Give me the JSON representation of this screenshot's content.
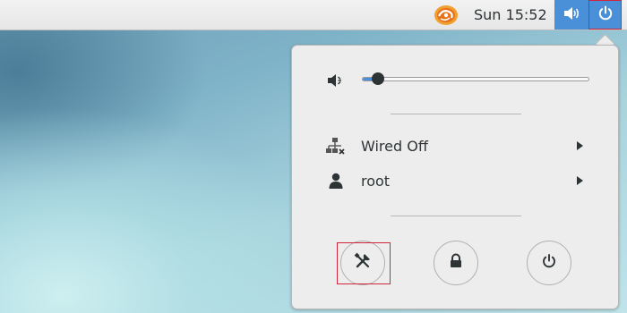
{
  "topbar": {
    "clock": "Sun 15:52",
    "icons": {
      "app": "app-menu-swirl-icon",
      "volume": "volume-icon",
      "power": "power-icon"
    },
    "accent_color": "#4a90d9"
  },
  "menu": {
    "volume": {
      "icon": "speaker-muted-icon",
      "level_percent": 7
    },
    "network": {
      "icon": "network-wired-disconnected-icon",
      "label": "Wired Off"
    },
    "user": {
      "icon": "user-icon",
      "label": "root"
    },
    "actions": [
      {
        "icon": "settings-tools-icon",
        "name": "settings"
      },
      {
        "icon": "lock-icon",
        "name": "lock"
      },
      {
        "icon": "power-off-icon",
        "name": "power-off"
      }
    ]
  },
  "highlight_color": "#d0263b"
}
